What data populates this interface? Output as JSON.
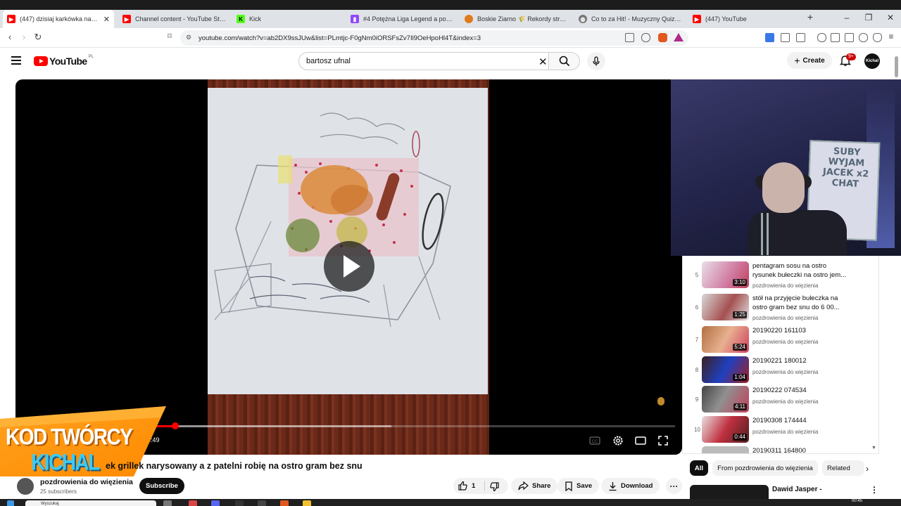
{
  "browser": {
    "tabs": [
      {
        "label": "(447) dzisiaj karkówka na obiadek",
        "favicon": "youtube-favicon",
        "active": true
      },
      {
        "label": "Channel content - YouTube Studio",
        "favicon": "youtube-studio-favicon"
      },
      {
        "label": "Kick",
        "favicon": "kick-favicon"
      },
      {
        "label": "#4 Potężna Liga Legend a potem",
        "favicon": "twitch-favicon"
      },
      {
        "label": "Boskie Ziarno 🌾 Rekordy streamera",
        "favicon": "kick-orange-favicon"
      },
      {
        "label": "Co to za Hit! - Muzyczny Quiz Hip-Hop",
        "favicon": "globe-favicon"
      },
      {
        "label": "(447) YouTube",
        "favicon": "youtube-favicon"
      }
    ],
    "new_tab": "+",
    "url": "youtube.com/watch?v=ab2DX9ssJUw&list=PLmtjc-F0gNm0iORSFsZv7Il9OeHpoHl4T&index=3"
  },
  "youtube": {
    "logo_text": "YouTube",
    "country_code": "PL",
    "search_query": "bartosz ufnal",
    "create_label": "Create",
    "notifications_badge": "9+",
    "avatar_text": "Kichal"
  },
  "player": {
    "time": "0:49",
    "progress_played_fraction": 0.05,
    "progress_buffered_fraction": 0.46
  },
  "webcam": {
    "board_text": "SUBY WYJAM JACEK x2 CHAT"
  },
  "overlay": {
    "line1": "KOD TWÓRCY",
    "line2": "KICHAL"
  },
  "video": {
    "title": "ek grillek narysowany a z patelni robię na ostro gram bez snu",
    "channel": "pozdrowienia do więzienia",
    "subscribers": "25 subscribers",
    "subscribe_label": "Subscribe",
    "likes": "1",
    "share_label": "Share",
    "save_label": "Save",
    "download_label": "Download"
  },
  "playlist": {
    "items": [
      {
        "index": "5",
        "title": "pentagram sosu na ostro rysunek bułeczki na ostro jem...",
        "channel": "pozdrowienia do więzienia",
        "duration": "3:10"
      },
      {
        "index": "6",
        "title": "stół na przyjęcie bułeczka na ostro gram bez snu do 6 00...",
        "channel": "pozdrowienia do więzienia",
        "duration": "1:25"
      },
      {
        "index": "7",
        "title": "20190220 161103",
        "channel": "pozdrowienia do więzienia",
        "duration": "5:24"
      },
      {
        "index": "8",
        "title": "20190221 180012",
        "channel": "pozdrowienia do więzienia",
        "duration": "1:04"
      },
      {
        "index": "9",
        "title": "20190222 074534",
        "channel": "pozdrowienia do więzienia",
        "duration": "4:11"
      },
      {
        "index": "10",
        "title": "20190308 174444",
        "channel": "pozdrowienia do więzienia",
        "duration": "0:44"
      },
      {
        "index": "",
        "title": "20190311 164800",
        "channel": "",
        "duration": ""
      }
    ]
  },
  "chips": {
    "all": "All",
    "from_channel": "From pozdrowienia do więzienia",
    "related": "Related"
  },
  "recommendation": {
    "title": "Dawid Jasper -"
  },
  "taskbar": {
    "search_placeholder": "Wyszukaj",
    "clock": "00:45"
  }
}
